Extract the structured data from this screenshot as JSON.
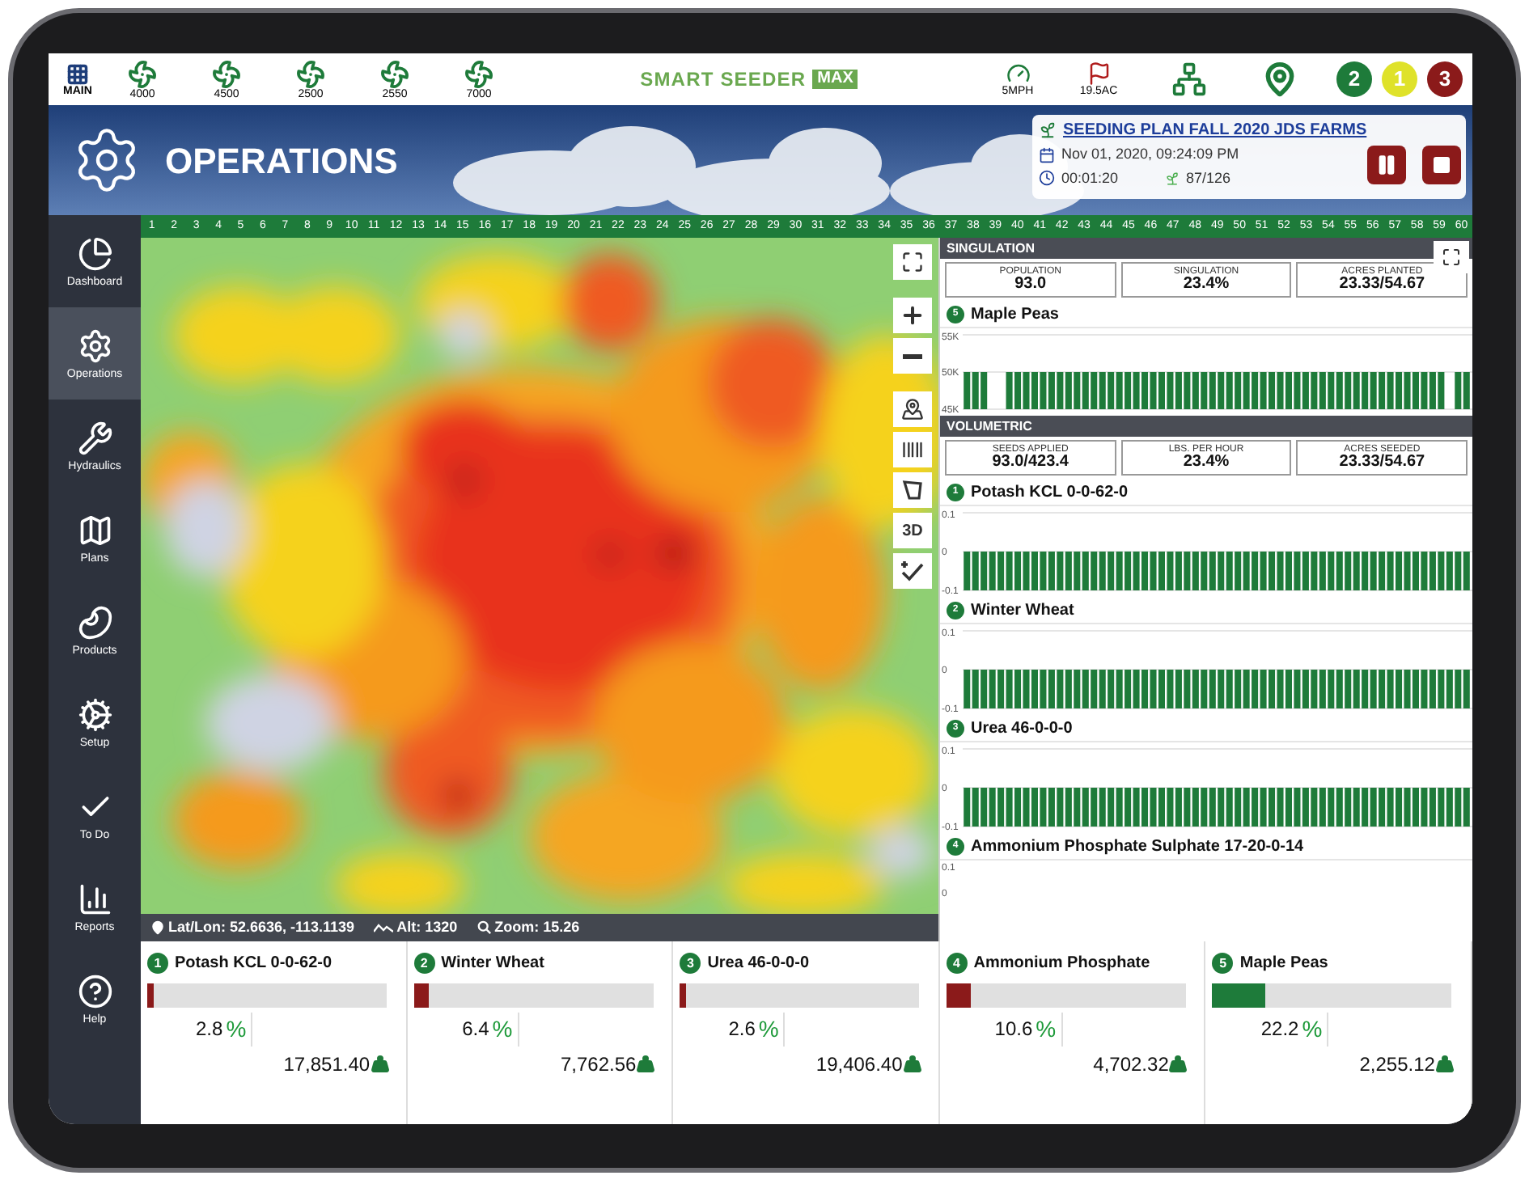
{
  "top_bar": {
    "main": {
      "label": "MAIN"
    },
    "fans": [
      {
        "label": "4000"
      },
      {
        "label": "4500"
      },
      {
        "label": "2500"
      },
      {
        "label": "2550"
      },
      {
        "label": "7000"
      }
    ],
    "logo": {
      "text": "SMART SEEDER",
      "badge": "MAX"
    },
    "speed": "5MPH",
    "acres": "19.5AC",
    "alerts": [
      {
        "label": "2",
        "color": "#1e7b3a"
      },
      {
        "label": "1",
        "color": "#dfe22a"
      },
      {
        "label": "3",
        "color": "#8b1a1a"
      }
    ]
  },
  "banner": {
    "title": "OPERATIONS",
    "plan": {
      "title": "SEEDING PLAN FALL 2020 JDS FARMS",
      "datetime": "Nov 01, 2020, 09:24:09 PM",
      "elapsed": "00:01:20",
      "rows": "87/126"
    }
  },
  "column_numbers": [
    "1",
    "2",
    "3",
    "4",
    "5",
    "6",
    "7",
    "8",
    "9",
    "10",
    "11",
    "12",
    "13",
    "14",
    "15",
    "16",
    "17",
    "18",
    "19",
    "20",
    "21",
    "22",
    "23",
    "24",
    "25",
    "26",
    "27",
    "28",
    "29",
    "30",
    "31",
    "32",
    "33",
    "34",
    "35",
    "36",
    "37",
    "38",
    "39",
    "40",
    "41",
    "42",
    "43",
    "44",
    "45",
    "46",
    "47",
    "48",
    "49",
    "50",
    "51",
    "52",
    "53",
    "54",
    "55",
    "56",
    "57",
    "58",
    "59",
    "60"
  ],
  "sidebar": {
    "items": [
      {
        "kind": "dashboard",
        "label": "Dashboard",
        "selected": false
      },
      {
        "kind": "operations",
        "label": "Operations",
        "selected": true
      },
      {
        "kind": "hydraulics",
        "label": "Hydraulics",
        "selected": false
      },
      {
        "kind": "plans",
        "label": "Plans",
        "selected": false
      },
      {
        "kind": "products",
        "label": "Products",
        "selected": false
      },
      {
        "kind": "setup",
        "label": "Setup",
        "selected": false
      },
      {
        "kind": "todo",
        "label": "To Do",
        "selected": false
      },
      {
        "kind": "reports",
        "label": "Reports",
        "selected": false
      },
      {
        "kind": "help",
        "label": "Help",
        "selected": false
      }
    ]
  },
  "map": {
    "controls": [
      {
        "kind": "fullscreen"
      },
      {
        "kind": "zoom_in"
      },
      {
        "kind": "zoom_out"
      },
      {
        "kind": "layers"
      },
      {
        "kind": "barcode"
      },
      {
        "kind": "polygon"
      },
      {
        "kind": "label",
        "label": "3D"
      },
      {
        "kind": "check"
      }
    ],
    "status": {
      "latlon": "Lat/Lon: 52.6636, -113.1139",
      "alt": "Alt: 1320",
      "zoom": "Zoom: 15.26"
    }
  },
  "right_panel": {
    "sections": [
      {
        "title": "SINGULATION",
        "stats": [
          {
            "label": "POPULATION",
            "value": "93.0"
          },
          {
            "label": "SINGULATION",
            "value": "23.4%"
          },
          {
            "label": "ACRES PLANTED",
            "value": "23.33/54.67"
          }
        ],
        "products": [
          {
            "number": "5",
            "name": "Maple Peas",
            "chart_data": {
              "type": "bar",
              "ylim": [
                45000,
                55000
              ],
              "yticks": [
                {
                  "value": 55000,
                  "label": "55K"
                },
                {
                  "value": 50000,
                  "label": "50K"
                },
                {
                  "value": 45000,
                  "label": "45K"
                }
              ],
              "values": [
                50000,
                50000,
                50000,
                null,
                null,
                50000,
                50000,
                50000,
                50000,
                50000,
                50000,
                50000,
                50000,
                50000,
                50000,
                50000,
                50000,
                50000,
                50000,
                50000,
                50000,
                50000,
                50000,
                50000,
                50000,
                50000,
                50000,
                50000,
                50000,
                50000,
                50000,
                50000,
                50000,
                50000,
                50000,
                50000,
                50000,
                50000,
                50000,
                50000,
                50000,
                50000,
                50000,
                50000,
                50000,
                50000,
                50000,
                50000,
                50000,
                50000,
                50000,
                50000,
                50000,
                50000,
                50000,
                50000,
                50000,
                null,
                50000,
                50000
              ]
            }
          }
        ]
      },
      {
        "title": "VOLUMETRIC",
        "stats": [
          {
            "label": "SEEDS APPLIED",
            "value": "93.0/423.4"
          },
          {
            "label": "LBS. PER HOUR",
            "value": "23.4%"
          },
          {
            "label": "ACRES SEEDED",
            "value": "23.33/54.67"
          }
        ],
        "products": [
          {
            "number": "1",
            "name": "Potash KCL 0-0-62-0",
            "chart_data": {
              "type": "bar",
              "ylim": [
                -0.1,
                0.1
              ],
              "yticks": [
                {
                  "value": 0.1,
                  "label": "0.1"
                },
                {
                  "value": 0,
                  "label": "0"
                },
                {
                  "value": -0.1,
                  "label": "-0.1"
                }
              ],
              "values": [
                -0.1,
                -0.1,
                -0.1,
                -0.1,
                -0.1,
                -0.1,
                -0.1,
                -0.1,
                -0.1,
                -0.1,
                -0.1,
                -0.1,
                -0.1,
                -0.1,
                -0.1,
                -0.1,
                -0.1,
                -0.1,
                -0.1,
                -0.1,
                -0.1,
                -0.1,
                -0.1,
                -0.1,
                -0.1,
                -0.1,
                -0.1,
                -0.1,
                -0.1,
                -0.1,
                -0.1,
                -0.1,
                -0.1,
                -0.1,
                -0.1,
                -0.1,
                -0.1,
                -0.1,
                -0.1,
                -0.1,
                -0.1,
                -0.1,
                -0.1,
                -0.1,
                -0.1,
                -0.1,
                -0.1,
                -0.1,
                -0.1,
                -0.1,
                -0.1,
                -0.1,
                -0.1,
                -0.1,
                -0.1,
                -0.1,
                -0.1,
                -0.1,
                -0.1,
                -0.1
              ]
            }
          },
          {
            "number": "2",
            "name": "Winter Wheat",
            "chart_data": {
              "type": "bar",
              "ylim": [
                -0.1,
                0.1
              ],
              "yticks": [
                {
                  "value": 0.1,
                  "label": "0.1"
                },
                {
                  "value": 0,
                  "label": "0"
                },
                {
                  "value": -0.1,
                  "label": "-0.1"
                }
              ],
              "values": [
                -0.1,
                -0.1,
                -0.1,
                -0.1,
                -0.1,
                -0.1,
                -0.1,
                -0.1,
                -0.1,
                -0.1,
                -0.1,
                -0.1,
                -0.1,
                -0.1,
                -0.1,
                -0.1,
                -0.1,
                -0.1,
                -0.1,
                -0.1,
                -0.1,
                -0.1,
                -0.1,
                -0.1,
                -0.1,
                -0.1,
                -0.1,
                -0.1,
                -0.1,
                -0.1,
                -0.1,
                -0.1,
                -0.1,
                -0.1,
                -0.1,
                -0.1,
                -0.1,
                -0.1,
                -0.1,
                -0.1,
                -0.1,
                -0.1,
                -0.1,
                -0.1,
                -0.1,
                -0.1,
                -0.1,
                -0.1,
                -0.1,
                -0.1,
                -0.1,
                -0.1,
                -0.1,
                -0.1,
                -0.1,
                -0.1,
                -0.1,
                -0.1,
                -0.1,
                -0.1
              ]
            }
          },
          {
            "number": "3",
            "name": "Urea 46-0-0-0",
            "chart_data": {
              "type": "bar",
              "ylim": [
                -0.1,
                0.1
              ],
              "yticks": [
                {
                  "value": 0.1,
                  "label": "0.1"
                },
                {
                  "value": 0,
                  "label": "0"
                },
                {
                  "value": -0.1,
                  "label": "-0.1"
                }
              ],
              "values": [
                -0.1,
                -0.1,
                -0.1,
                -0.1,
                -0.1,
                -0.1,
                -0.1,
                -0.1,
                -0.1,
                -0.1,
                -0.1,
                -0.1,
                -0.1,
                -0.1,
                -0.1,
                -0.1,
                -0.1,
                -0.1,
                -0.1,
                -0.1,
                -0.1,
                -0.1,
                -0.1,
                -0.1,
                -0.1,
                -0.1,
                -0.1,
                -0.1,
                -0.1,
                -0.1,
                -0.1,
                -0.1,
                -0.1,
                -0.1,
                -0.1,
                -0.1,
                -0.1,
                -0.1,
                -0.1,
                -0.1,
                -0.1,
                -0.1,
                -0.1,
                -0.1,
                -0.1,
                -0.1,
                -0.1,
                -0.1,
                -0.1,
                -0.1,
                -0.1,
                -0.1,
                -0.1,
                -0.1,
                -0.1,
                -0.1,
                -0.1,
                -0.1,
                -0.1,
                -0.1
              ]
            }
          },
          {
            "number": "4",
            "name": "Ammonium Phosphate Sulphate 17-20-0-14",
            "axis_labels": [
              "0.1",
              "0"
            ]
          }
        ]
      }
    ]
  },
  "product_cards": [
    {
      "number": "1",
      "name": "Potash KCL 0-0-62-0",
      "level": 0.028,
      "color": "#8b1a1a",
      "percent": "2.8",
      "percent_sign": "%",
      "amount": "17,851.40"
    },
    {
      "number": "2",
      "name": "Winter Wheat",
      "level": 0.064,
      "color": "#8b1a1a",
      "percent": "6.4",
      "percent_sign": "%",
      "amount": "7,762.56"
    },
    {
      "number": "3",
      "name": "Urea 46-0-0-0",
      "level": 0.026,
      "color": "#8b1a1a",
      "percent": "2.6",
      "percent_sign": "%",
      "amount": "19,406.40"
    },
    {
      "number": "4",
      "name": "Ammonium Phosphate",
      "level": 0.106,
      "color": "#8b1a1a",
      "percent": "10.6",
      "percent_sign": "%",
      "amount": "4,702.32"
    },
    {
      "number": "5",
      "name": "Maple Peas",
      "level": 0.222,
      "color": "#1e7b3a",
      "percent": "22.2",
      "percent_sign": "%",
      "amount": "2,255.12"
    }
  ]
}
